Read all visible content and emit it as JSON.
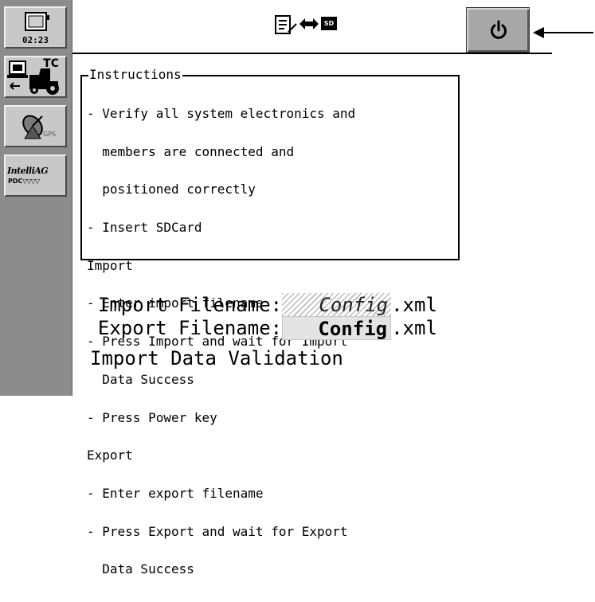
{
  "sidebar": {
    "clock": "02:23",
    "tc_label": "TC",
    "gps_label": "GPS",
    "intelliag_label": "IntelliAG",
    "pdc_label": "PDC"
  },
  "header": {
    "icons": [
      "document-edit-icon",
      "transfer-arrows-icon",
      "sd-card-icon",
      "hourglass-icon"
    ],
    "sd_label": "SD",
    "power_icon": "power-icon"
  },
  "instructions": {
    "title": "Instructions",
    "lines": [
      "- Verify all system electronics and",
      "  members are connected and",
      "  positioned correctly",
      "- Insert SDCard",
      "Import",
      "- Enter import filename",
      "- Press Import and wait for Import",
      "  Data Success",
      "- Press Power key",
      "Export",
      "- Enter export filename",
      "- Press Export and wait for Export",
      "  Data Success"
    ]
  },
  "import_field": {
    "label": "Import Filename:",
    "value": "Config",
    "ext": ".xml"
  },
  "export_field": {
    "label": "Export Filename:",
    "value": "Config",
    "ext": ".xml"
  },
  "status": {
    "text": "Import Data Validation"
  },
  "colors": {
    "sidebar": "#8c8c8c",
    "button_face": "#c8c8c8",
    "power_button": "#a8a8a8"
  }
}
